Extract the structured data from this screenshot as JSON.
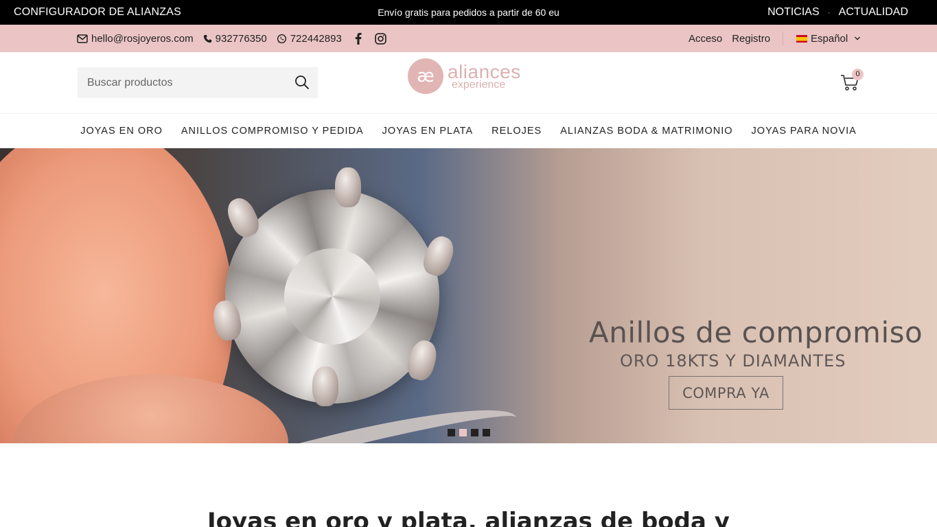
{
  "topbar": {
    "left_link": "CONFIGURADOR DE ALIANZAS",
    "promo": "Envío gratis para pedidos a partir de 60 eu",
    "right_links": [
      "NOTICIAS",
      "ACTUALIDAD"
    ],
    "separator": "·"
  },
  "contactbar": {
    "email": "hello@rosjoyeros.com",
    "phone": "932776350",
    "whatsapp": "722442893",
    "login": "Acceso",
    "register": "Registro",
    "language": "Español"
  },
  "header": {
    "search_placeholder": "Buscar productos",
    "logo_mark": "æ",
    "logo_line1": "aliances",
    "logo_line2": "experience",
    "cart_count": "0"
  },
  "nav": {
    "items": [
      "JOYAS EN ORO",
      "ANILLOS COMPROMISO Y PEDIDA",
      "JOYAS EN PLATA",
      "RELOJES",
      "ALIANZAS BODA & MATRIMONIO",
      "JOYAS PARA NOVIA"
    ]
  },
  "hero": {
    "title": "Anillos de compromiso",
    "subtitle": "ORO 18KTS Y DIAMANTES",
    "cta": "COMPRA YA",
    "slides": 4,
    "active_slide": 2
  },
  "section": {
    "title": "Joyas en oro y plata, alianzas de boda y"
  },
  "colors": {
    "topbar_bg": "#000000",
    "accent_pink": "#ebc5c5",
    "logo_pink": "#ddb0b0"
  }
}
